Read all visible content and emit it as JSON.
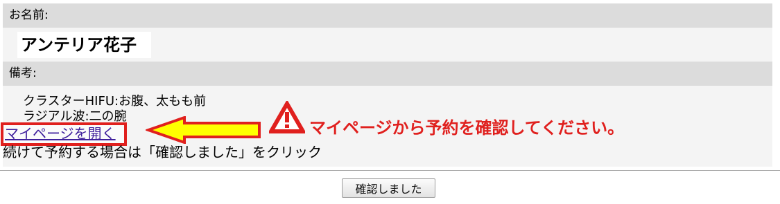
{
  "form": {
    "name_label": "お名前:",
    "name_value": "アンテリア花子",
    "notes_label": "備考:",
    "notes_lines": [
      "クラスターHIFU:お腹、太もも前",
      "ラジアル波:二の腕"
    ]
  },
  "mypage_link": {
    "label": "マイページを開く"
  },
  "callout": {
    "text": "マイページから予約を確認してください。",
    "icon": "warning-icon",
    "arrow": "left-arrow-icon",
    "color": "#e0201e",
    "arrow_fill": "#ffff00"
  },
  "instructions": {
    "text": "続けて予約する場合は「確認しました」をクリック"
  },
  "actions": {
    "confirm_label": "確認しました"
  }
}
